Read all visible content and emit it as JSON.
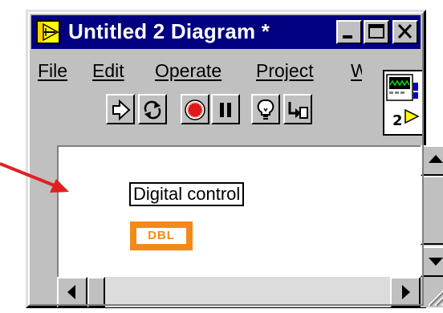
{
  "window": {
    "title": "Untitled 2 Diagram *",
    "caption_buttons": [
      "minimize-icon",
      "maximize-icon",
      "close-icon"
    ]
  },
  "menu": {
    "items": [
      "File",
      "Edit",
      "Operate",
      "Project",
      "W"
    ]
  },
  "toolbar": {
    "buttons": [
      "run-arrow-icon",
      "run-continuously-icon",
      "abort-execution-icon",
      "pause-icon",
      "highlight-execution-bulb-icon",
      "step-into-icon"
    ]
  },
  "context_help": {
    "number": "2",
    "icon": "vi-icon"
  },
  "diagram": {
    "label": "Digital control",
    "terminal_text": "DBL"
  },
  "colors": {
    "titlebar": "#000080",
    "face": "#c0c0c0",
    "terminal": "#f28a1a",
    "annotation_arrow": "#e02020"
  }
}
